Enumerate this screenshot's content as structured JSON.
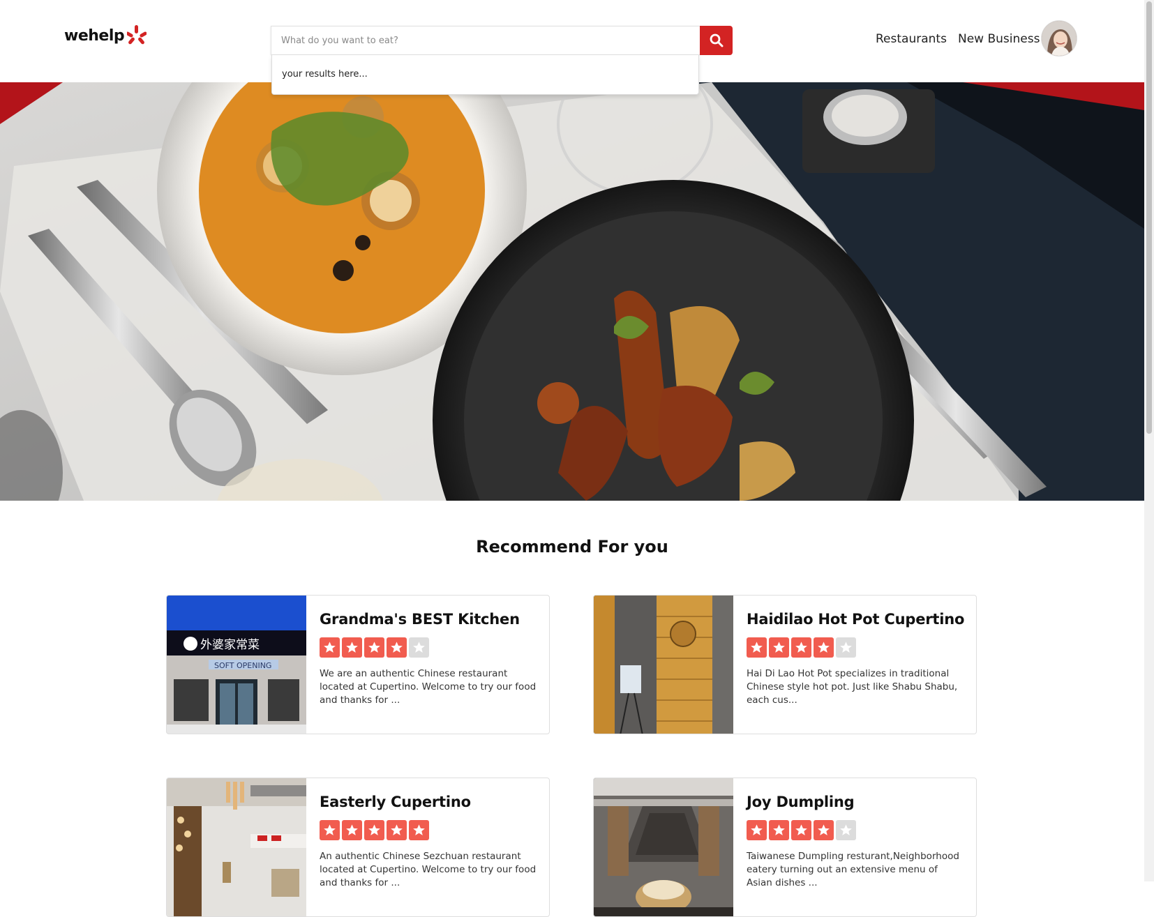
{
  "header": {
    "logo_text": "wehelp",
    "search": {
      "placeholder": "What do you want to eat?",
      "value": ""
    },
    "search_results": "your results here...",
    "nav": {
      "restaurants": "Restaurants",
      "new_business": "New Business"
    }
  },
  "section": {
    "title": "Recommend For you"
  },
  "restaurants": [
    {
      "name": "Grandma's BEST Kitchen",
      "rating": 4,
      "description": "We are an authentic Chinese restaurant located at Cupertino. Welcome to try our food and thanks for ...",
      "photo_sign": "外婆家常菜",
      "photo_banner": "SOFT OPENING"
    },
    {
      "name": "Haidilao Hot Pot Cupertino",
      "rating": 4,
      "description": "Hai Di Lao Hot Pot specializes in traditional Chinese style hot pot. Just like Shabu Shabu, each cus..."
    },
    {
      "name": "Easterly Cupertino",
      "rating": 5,
      "description": "An authentic Chinese Sezchuan restaurant located at Cupertino. Welcome to try our food and thanks for ..."
    },
    {
      "name": "Joy Dumpling",
      "rating": 4,
      "description": "Taiwanese Dumpling resturant,Neighborhood eatery turning out an extensive menu of Asian dishes ..."
    }
  ],
  "colors": {
    "brand_red": "#d32323",
    "star_on": "#f15c4f",
    "star_off": "#dcdcdc"
  }
}
